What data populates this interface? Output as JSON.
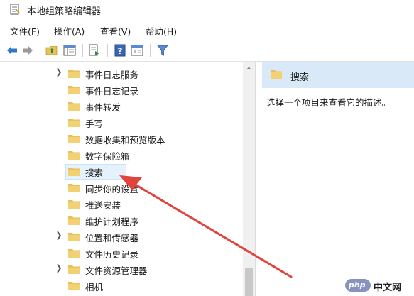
{
  "window": {
    "title": "本地组策略编辑器"
  },
  "menu": [
    {
      "label": "文件(F)"
    },
    {
      "label": "操作(A)"
    },
    {
      "label": "查看(V)"
    },
    {
      "label": "帮助(H)"
    }
  ],
  "toolbar": {
    "icons": [
      "back-icon",
      "forward-icon",
      "up-folder-icon",
      "show-hide-tree-icon",
      "export-list-icon",
      "help-icon",
      "properties-icon",
      "filter-icon"
    ]
  },
  "tree": {
    "items": [
      {
        "label": "事件日志服务",
        "expandable": true
      },
      {
        "label": "事件日志记录",
        "expandable": false
      },
      {
        "label": "事件转发",
        "expandable": false
      },
      {
        "label": "手写",
        "expandable": false
      },
      {
        "label": "数据收集和预览版本",
        "expandable": false
      },
      {
        "label": "数字保险箱",
        "expandable": false
      },
      {
        "label": "搜索",
        "expandable": false,
        "selected": true
      },
      {
        "label": "同步你的设置",
        "expandable": false
      },
      {
        "label": "推送安装",
        "expandable": false
      },
      {
        "label": "维护计划程序",
        "expandable": false
      },
      {
        "label": "位置和传感器",
        "expandable": true
      },
      {
        "label": "文件历史记录",
        "expandable": false
      },
      {
        "label": "文件资源管理器",
        "expandable": true
      },
      {
        "label": "相机",
        "expandable": false
      }
    ]
  },
  "right_pane": {
    "header_title": "搜索",
    "description": "选择一个项目来查看它的描述。"
  },
  "watermark": {
    "php": "php",
    "cn": "中文网"
  },
  "colors": {
    "folder": "#e8c15a",
    "folder_dark": "#d1a43a",
    "selection": "#e5f1fb",
    "header_bg": "#d9e9f7",
    "arrow": "#e0443c"
  }
}
